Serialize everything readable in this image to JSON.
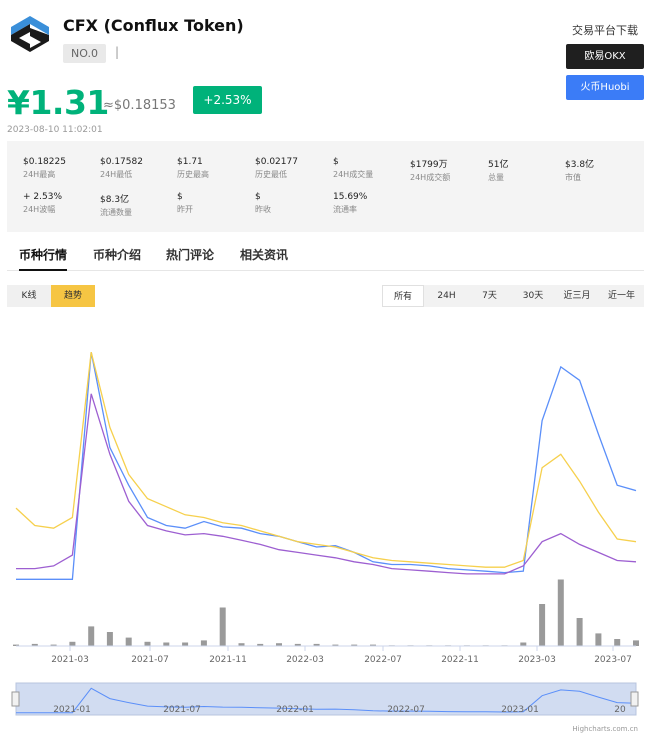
{
  "header": {
    "title": "CFX (Conflux Token)",
    "rank": "NO.0",
    "separator": "|",
    "price": "¥1.31",
    "price_usd": "≈$0.18153",
    "change": "+2.53%",
    "timestamp": "2023-08-10 11:02:01"
  },
  "exchange": {
    "title": "交易平台下载",
    "okx": "欧易OKX",
    "huobi": "火币Huobi"
  },
  "stats": [
    {
      "value": "$0.18225",
      "label": "24H最高"
    },
    {
      "value": "$0.17582",
      "label": "24H最低"
    },
    {
      "value": "$1.71",
      "label": "历史最高"
    },
    {
      "value": "$0.02177",
      "label": "历史最低"
    },
    {
      "value": "$",
      "label": "24H成交量"
    },
    {
      "value": "$1799万",
      "label": "24H成交额"
    },
    {
      "value": "51亿",
      "label": "总量"
    },
    {
      "value": "$3.8亿",
      "label": "市值"
    },
    {
      "value": "+ 2.53%",
      "label": "24H波幅"
    },
    {
      "value": "$8.3亿",
      "label": "流通数量"
    },
    {
      "value": "$",
      "label": "昨开"
    },
    {
      "value": "$",
      "label": "昨收"
    },
    {
      "value": "15.69%",
      "label": "流通率"
    }
  ],
  "tabs": [
    "币种行情",
    "币种介绍",
    "热门评论",
    "相关资讯"
  ],
  "view_toggle": [
    "K线",
    "趋势"
  ],
  "ranges": [
    "所有",
    "24H",
    "7天",
    "30天",
    "近三月",
    "近一年"
  ],
  "credit": "Highcharts.com.cn",
  "colors": {
    "blue": "#5b8ff9",
    "yellow": "#f6d04d",
    "purple": "#9d5fd1",
    "volume": "#9a9a9a",
    "accent": "#00b27a"
  },
  "chart_data": {
    "type": "line",
    "x_ticks": [
      "2021-03",
      "2021-07",
      "2021-11",
      "2022-03",
      "2022-07",
      "2022-11",
      "2023-03",
      "2023-07"
    ],
    "navigator_ticks": [
      "2021-01",
      "2021-07",
      "2022-01",
      "2022-07",
      "2023-01",
      "20"
    ],
    "x": [
      "2020-11",
      "2020-12",
      "2021-01",
      "2021-02",
      "2021-03",
      "2021-04",
      "2021-05",
      "2021-06",
      "2021-07",
      "2021-08",
      "2021-09",
      "2021-10",
      "2021-11",
      "2021-12",
      "2022-01",
      "2022-02",
      "2022-03",
      "2022-04",
      "2022-05",
      "2022-06",
      "2022-07",
      "2022-08",
      "2022-09",
      "2022-10",
      "2022-11",
      "2022-12",
      "2023-01",
      "2023-02",
      "2023-03",
      "2023-04",
      "2023-05",
      "2023-06",
      "2023-07",
      "2023-08"
    ],
    "series": [
      {
        "values": [
          0.02,
          0.02,
          0.02,
          0.02,
          1.71,
          1.0,
          0.72,
          0.48,
          0.42,
          0.4,
          0.45,
          0.41,
          0.4,
          0.36,
          0.34,
          0.3,
          0.26,
          0.27,
          0.22,
          0.15,
          0.13,
          0.13,
          0.12,
          0.1,
          0.09,
          0.08,
          0.07,
          0.08,
          1.2,
          1.6,
          1.5,
          1.1,
          0.72,
          0.68
        ]
      },
      {
        "values": [
          0.55,
          0.42,
          0.4,
          0.48,
          1.71,
          1.15,
          0.8,
          0.62,
          0.56,
          0.5,
          0.48,
          0.44,
          0.42,
          0.38,
          0.34,
          0.3,
          0.28,
          0.26,
          0.22,
          0.18,
          0.16,
          0.15,
          0.14,
          0.13,
          0.12,
          0.11,
          0.11,
          0.16,
          0.85,
          0.95,
          0.75,
          0.52,
          0.32,
          0.3
        ]
      },
      {
        "values": [
          0.1,
          0.1,
          0.12,
          0.2,
          1.4,
          0.95,
          0.6,
          0.42,
          0.38,
          0.35,
          0.36,
          0.34,
          0.31,
          0.28,
          0.24,
          0.22,
          0.2,
          0.18,
          0.15,
          0.13,
          0.1,
          0.09,
          0.08,
          0.07,
          0.06,
          0.06,
          0.06,
          0.12,
          0.3,
          0.36,
          0.28,
          0.22,
          0.16,
          0.15
        ]
      }
    ],
    "volume": [
      0.02,
      0.03,
      0.02,
      0.06,
      0.28,
      0.2,
      0.12,
      0.06,
      0.05,
      0.05,
      0.08,
      0.55,
      0.04,
      0.03,
      0.04,
      0.03,
      0.03,
      0.02,
      0.02,
      0.02,
      0.01,
      0.01,
      0.01,
      0.01,
      0.01,
      0.01,
      0.01,
      0.05,
      0.6,
      0.95,
      0.4,
      0.18,
      0.1,
      0.08
    ],
    "ylim": [
      0,
      1.8
    ]
  }
}
